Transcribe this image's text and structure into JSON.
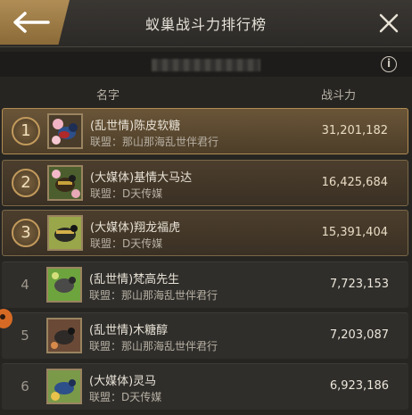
{
  "header": {
    "title": "蚁巢战斗力排行榜",
    "back_icon": "arrow-left-icon",
    "close_icon": "close-icon"
  },
  "info_icon": "info-icon",
  "columns": {
    "name": "名字",
    "power": "战斗力"
  },
  "alliance_label": "联盟：",
  "rows": [
    {
      "rank": "1",
      "name": "(乱世情)陈皮软糖",
      "alliance": "联盟：那山那海乱世伴君行",
      "power": "31,201,182"
    },
    {
      "rank": "2",
      "name": "(大媒体)基情大马达",
      "alliance": "联盟：D天传媒",
      "power": "16,425,684"
    },
    {
      "rank": "3",
      "name": "(大媒体)翔龙福虎",
      "alliance": "联盟：D天传媒",
      "power": "15,391,404"
    },
    {
      "rank": "4",
      "name": "(乱世情)梵高先生",
      "alliance": "联盟：那山那海乱世伴君行",
      "power": "7,723,153"
    },
    {
      "rank": "5",
      "name": "(乱世情)木糖醇",
      "alliance": "联盟：那山那海乱世伴君行",
      "power": "7,203,087"
    },
    {
      "rank": "6",
      "name": "(大媒体)灵马",
      "alliance": "联盟：D天传媒",
      "power": "6,923,186"
    }
  ]
}
